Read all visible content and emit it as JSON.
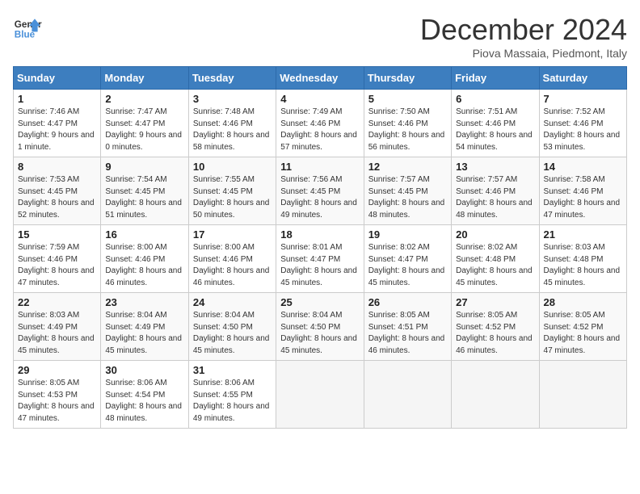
{
  "logo": {
    "line1": "General",
    "line2": "Blue"
  },
  "title": "December 2024",
  "subtitle": "Piova Massaia, Piedmont, Italy",
  "headers": [
    "Sunday",
    "Monday",
    "Tuesday",
    "Wednesday",
    "Thursday",
    "Friday",
    "Saturday"
  ],
  "weeks": [
    [
      {
        "day": "1",
        "rise": "Sunrise: 7:46 AM",
        "set": "Sunset: 4:47 PM",
        "daylight": "Daylight: 9 hours and 1 minute."
      },
      {
        "day": "2",
        "rise": "Sunrise: 7:47 AM",
        "set": "Sunset: 4:47 PM",
        "daylight": "Daylight: 9 hours and 0 minutes."
      },
      {
        "day": "3",
        "rise": "Sunrise: 7:48 AM",
        "set": "Sunset: 4:46 PM",
        "daylight": "Daylight: 8 hours and 58 minutes."
      },
      {
        "day": "4",
        "rise": "Sunrise: 7:49 AM",
        "set": "Sunset: 4:46 PM",
        "daylight": "Daylight: 8 hours and 57 minutes."
      },
      {
        "day": "5",
        "rise": "Sunrise: 7:50 AM",
        "set": "Sunset: 4:46 PM",
        "daylight": "Daylight: 8 hours and 56 minutes."
      },
      {
        "day": "6",
        "rise": "Sunrise: 7:51 AM",
        "set": "Sunset: 4:46 PM",
        "daylight": "Daylight: 8 hours and 54 minutes."
      },
      {
        "day": "7",
        "rise": "Sunrise: 7:52 AM",
        "set": "Sunset: 4:46 PM",
        "daylight": "Daylight: 8 hours and 53 minutes."
      }
    ],
    [
      {
        "day": "8",
        "rise": "Sunrise: 7:53 AM",
        "set": "Sunset: 4:45 PM",
        "daylight": "Daylight: 8 hours and 52 minutes."
      },
      {
        "day": "9",
        "rise": "Sunrise: 7:54 AM",
        "set": "Sunset: 4:45 PM",
        "daylight": "Daylight: 8 hours and 51 minutes."
      },
      {
        "day": "10",
        "rise": "Sunrise: 7:55 AM",
        "set": "Sunset: 4:45 PM",
        "daylight": "Daylight: 8 hours and 50 minutes."
      },
      {
        "day": "11",
        "rise": "Sunrise: 7:56 AM",
        "set": "Sunset: 4:45 PM",
        "daylight": "Daylight: 8 hours and 49 minutes."
      },
      {
        "day": "12",
        "rise": "Sunrise: 7:57 AM",
        "set": "Sunset: 4:45 PM",
        "daylight": "Daylight: 8 hours and 48 minutes."
      },
      {
        "day": "13",
        "rise": "Sunrise: 7:57 AM",
        "set": "Sunset: 4:46 PM",
        "daylight": "Daylight: 8 hours and 48 minutes."
      },
      {
        "day": "14",
        "rise": "Sunrise: 7:58 AM",
        "set": "Sunset: 4:46 PM",
        "daylight": "Daylight: 8 hours and 47 minutes."
      }
    ],
    [
      {
        "day": "15",
        "rise": "Sunrise: 7:59 AM",
        "set": "Sunset: 4:46 PM",
        "daylight": "Daylight: 8 hours and 47 minutes."
      },
      {
        "day": "16",
        "rise": "Sunrise: 8:00 AM",
        "set": "Sunset: 4:46 PM",
        "daylight": "Daylight: 8 hours and 46 minutes."
      },
      {
        "day": "17",
        "rise": "Sunrise: 8:00 AM",
        "set": "Sunset: 4:46 PM",
        "daylight": "Daylight: 8 hours and 46 minutes."
      },
      {
        "day": "18",
        "rise": "Sunrise: 8:01 AM",
        "set": "Sunset: 4:47 PM",
        "daylight": "Daylight: 8 hours and 45 minutes."
      },
      {
        "day": "19",
        "rise": "Sunrise: 8:02 AM",
        "set": "Sunset: 4:47 PM",
        "daylight": "Daylight: 8 hours and 45 minutes."
      },
      {
        "day": "20",
        "rise": "Sunrise: 8:02 AM",
        "set": "Sunset: 4:48 PM",
        "daylight": "Daylight: 8 hours and 45 minutes."
      },
      {
        "day": "21",
        "rise": "Sunrise: 8:03 AM",
        "set": "Sunset: 4:48 PM",
        "daylight": "Daylight: 8 hours and 45 minutes."
      }
    ],
    [
      {
        "day": "22",
        "rise": "Sunrise: 8:03 AM",
        "set": "Sunset: 4:49 PM",
        "daylight": "Daylight: 8 hours and 45 minutes."
      },
      {
        "day": "23",
        "rise": "Sunrise: 8:04 AM",
        "set": "Sunset: 4:49 PM",
        "daylight": "Daylight: 8 hours and 45 minutes."
      },
      {
        "day": "24",
        "rise": "Sunrise: 8:04 AM",
        "set": "Sunset: 4:50 PM",
        "daylight": "Daylight: 8 hours and 45 minutes."
      },
      {
        "day": "25",
        "rise": "Sunrise: 8:04 AM",
        "set": "Sunset: 4:50 PM",
        "daylight": "Daylight: 8 hours and 45 minutes."
      },
      {
        "day": "26",
        "rise": "Sunrise: 8:05 AM",
        "set": "Sunset: 4:51 PM",
        "daylight": "Daylight: 8 hours and 46 minutes."
      },
      {
        "day": "27",
        "rise": "Sunrise: 8:05 AM",
        "set": "Sunset: 4:52 PM",
        "daylight": "Daylight: 8 hours and 46 minutes."
      },
      {
        "day": "28",
        "rise": "Sunrise: 8:05 AM",
        "set": "Sunset: 4:52 PM",
        "daylight": "Daylight: 8 hours and 47 minutes."
      }
    ],
    [
      {
        "day": "29",
        "rise": "Sunrise: 8:05 AM",
        "set": "Sunset: 4:53 PM",
        "daylight": "Daylight: 8 hours and 47 minutes."
      },
      {
        "day": "30",
        "rise": "Sunrise: 8:06 AM",
        "set": "Sunset: 4:54 PM",
        "daylight": "Daylight: 8 hours and 48 minutes."
      },
      {
        "day": "31",
        "rise": "Sunrise: 8:06 AM",
        "set": "Sunset: 4:55 PM",
        "daylight": "Daylight: 8 hours and 49 minutes."
      },
      null,
      null,
      null,
      null
    ]
  ]
}
